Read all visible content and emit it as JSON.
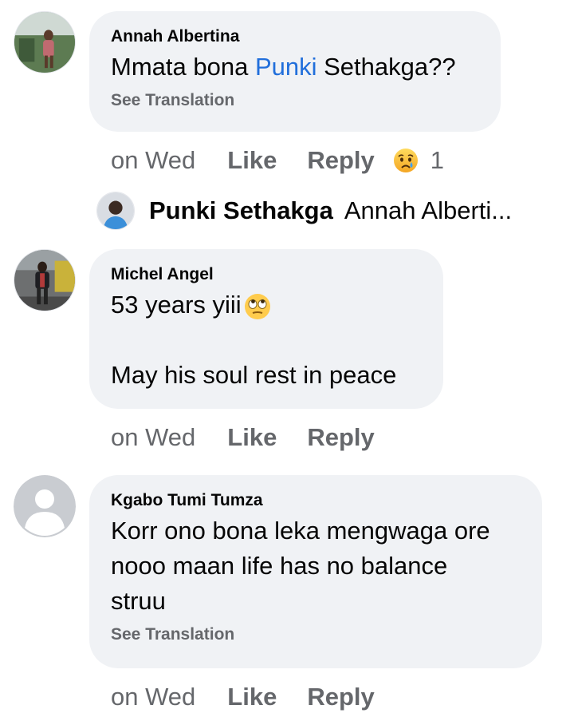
{
  "comments": [
    {
      "author": "Annah Albertina",
      "text_before": "Mmata bona ",
      "mention": "Punki",
      "text_after": " Sethakga??",
      "see_translation": "See Translation",
      "time": "on Wed",
      "like": "Like",
      "reply": "Reply",
      "reaction_icon": "sad-tear-emoji-icon",
      "reaction_count": "1"
    },
    {
      "author": "Michel Angel",
      "line1": "53 years yiii",
      "inline_emoji": "eye-roll-emoji-icon",
      "line2": "May his soul rest in peace",
      "time": "on Wed",
      "like": "Like",
      "reply": "Reply"
    },
    {
      "author": "Kgabo Tumi Tumza",
      "text": "Korr ono bona leka mengwaga ore\nnooo maan life has no balance\nstruu",
      "see_translation": "See Translation",
      "time": "on Wed",
      "like": "Like",
      "reply": "Reply"
    }
  ],
  "reply_preview": {
    "author": "Punki Sethakga",
    "snippet": "Annah Alberti..."
  },
  "colors": {
    "bubble": "#f0f2f5",
    "mention": "#216fdb",
    "secondary_text": "#65676b"
  }
}
